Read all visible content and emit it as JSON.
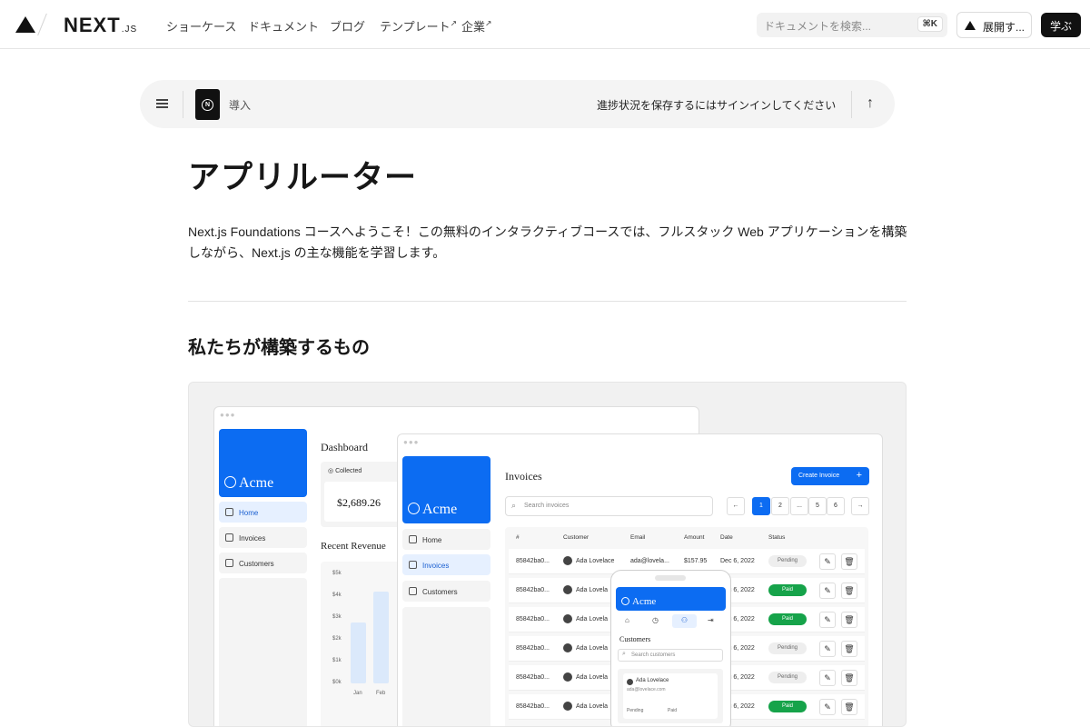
{
  "nav": {
    "brand": "NEXT",
    "brand_suffix": ".JS",
    "links": [
      "ショーケース",
      "ドキュメント",
      "ブログ",
      "テンプレート",
      "企業"
    ],
    "external_mark": "↗",
    "search_placeholder": "ドキュメントを検索...",
    "search_shortcut": "⌘K",
    "deploy_label": "展開す...",
    "learn_label": "学ぶ"
  },
  "progress": {
    "chapter": "導入",
    "signin_prompt": "進捗状況を保存するにはサインインしてください"
  },
  "page": {
    "title": "アプリルーター",
    "intro": "Next.js Foundations コースへようこそ！この無料のインタラクティブコースでは、フルスタック Web アプリケーションを構築しながら、Next.js の主な機能を学習します。",
    "section_title": "私たちが構築するもの"
  },
  "illustration": {
    "brand": "Acme",
    "nav_items": [
      "Home",
      "Invoices",
      "Customers"
    ],
    "dashboard": {
      "title": "Dashboard",
      "card_label": "Collected",
      "card_value": "$2,689.26",
      "revenue_title": "Recent Revenue",
      "y_ticks": [
        "$5k",
        "$4k",
        "$3k",
        "$2k",
        "$1k",
        "$0k"
      ],
      "months": [
        "Jan",
        "Feb"
      ],
      "revenue": [
        2.8,
        4.2
      ]
    },
    "invoices": {
      "title": "Invoices",
      "create_label": "Create Invoice",
      "search_placeholder": "Search invoices",
      "pages": [
        "1",
        "2",
        "...",
        "5",
        "6"
      ],
      "columns": [
        "#",
        "Customer",
        "Email",
        "Amount",
        "Date",
        "Status"
      ],
      "rows": [
        {
          "id": "85842ba0...",
          "customer": "Ada Lovelace",
          "email": "ada@lovela...",
          "amount": "$157.95",
          "date": "Dec 6, 2022",
          "status": "Pending"
        },
        {
          "id": "85842ba0...",
          "customer": "Ada Lovela",
          "email": "",
          "amount": "",
          "date": "Dec 6, 2022",
          "status": "Paid"
        },
        {
          "id": "85842ba0...",
          "customer": "Ada Lovela",
          "email": "",
          "amount": "",
          "date": "Dec 6, 2022",
          "status": "Paid"
        },
        {
          "id": "85842ba0...",
          "customer": "Ada Lovela",
          "email": "",
          "amount": "",
          "date": "Dec 6, 2022",
          "status": "Pending"
        },
        {
          "id": "85842ba0...",
          "customer": "Ada Lovela",
          "email": "",
          "amount": "",
          "date": "Dec 6, 2022",
          "status": "Pending"
        },
        {
          "id": "85842ba0...",
          "customer": "Ada Lovela",
          "email": "",
          "amount": "",
          "date": "Dec 6, 2022",
          "status": "Paid"
        }
      ]
    },
    "mobile": {
      "customers_title": "Customers",
      "search_placeholder": "Search customers",
      "customer_name": "Ada Lovelace",
      "customer_email": "ada@lovelace.com",
      "stat_labels": [
        "Pending",
        "Paid"
      ]
    }
  }
}
